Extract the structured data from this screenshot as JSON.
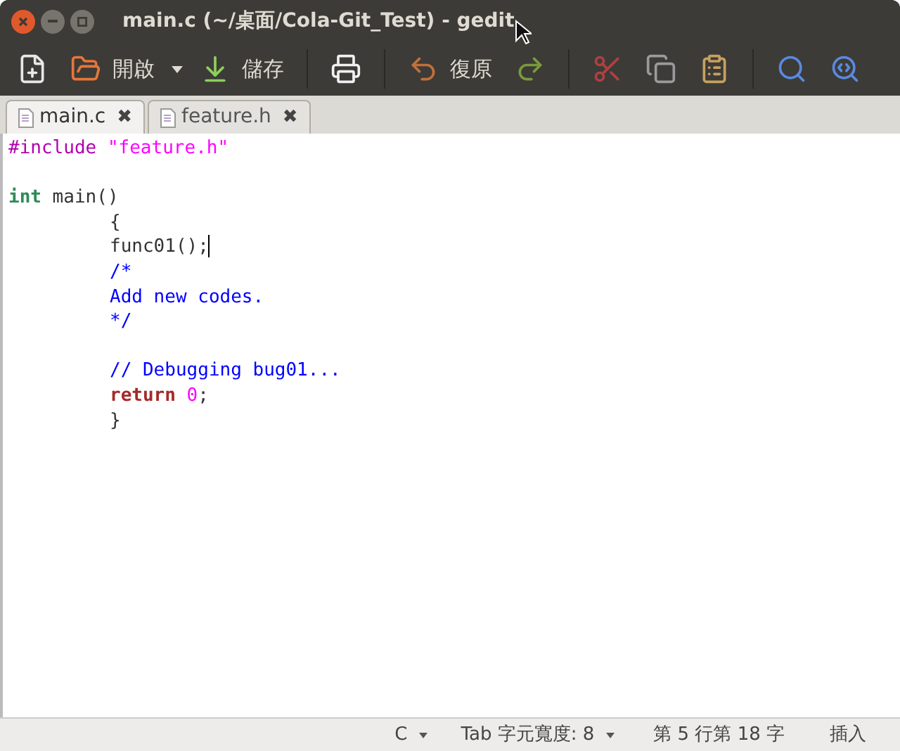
{
  "window": {
    "title": "main.c (~/桌面/Cola-Git_Test) - gedit"
  },
  "toolbar": [
    {
      "kind": "new"
    },
    {
      "kind": "open",
      "label": "開啟"
    },
    {
      "kind": "dropdown"
    },
    {
      "kind": "save",
      "label": "儲存"
    },
    {
      "kind": "separator"
    },
    {
      "kind": "print"
    },
    {
      "kind": "separator"
    },
    {
      "kind": "undo",
      "label": "復原"
    },
    {
      "kind": "redo"
    },
    {
      "kind": "separator"
    },
    {
      "kind": "cut"
    },
    {
      "kind": "copy"
    },
    {
      "kind": "paste"
    },
    {
      "kind": "separator"
    },
    {
      "kind": "find"
    },
    {
      "kind": "replace"
    }
  ],
  "tabs": [
    {
      "label": "main.c",
      "close": "✖",
      "selected": true
    },
    {
      "label": "feature.h",
      "close": "✖",
      "selected": false
    }
  ],
  "editor": {
    "lines": [
      {
        "kind": "code",
        "tokens": [
          {
            "kind": "preproc",
            "text": "#include "
          },
          {
            "kind": "string",
            "text": "\"feature.h\""
          }
        ]
      },
      {
        "kind": "blank"
      },
      {
        "kind": "code",
        "tokens": [
          {
            "kind": "type",
            "text": "int"
          },
          {
            "kind": "plain",
            "text": " main()"
          }
        ],
        "children": [
          {
            "kind": "code",
            "tokens": [
              {
                "kind": "plain",
                "text": "{"
              }
            ]
          },
          {
            "kind": "code",
            "cursor": true,
            "tokens": [
              {
                "kind": "plain",
                "text": "func01();"
              }
            ]
          },
          {
            "kind": "code",
            "tokens": [
              {
                "kind": "comment",
                "text": "/*"
              }
            ]
          },
          {
            "kind": "code",
            "tokens": [
              {
                "kind": "comment",
                "text": "Add new codes."
              }
            ]
          },
          {
            "kind": "code",
            "tokens": [
              {
                "kind": "comment",
                "text": "*/"
              }
            ]
          },
          {
            "kind": "blank"
          },
          {
            "kind": "code",
            "tokens": [
              {
                "kind": "comment",
                "text": "// Debugging bug01..."
              }
            ]
          },
          {
            "kind": "code",
            "tokens": [
              {
                "kind": "keyword",
                "text": "return "
              },
              {
                "kind": "number",
                "text": "0"
              },
              {
                "kind": "plain",
                "text": ";"
              }
            ]
          },
          {
            "kind": "code",
            "tokens": [
              {
                "kind": "plain",
                "text": "}"
              }
            ]
          }
        ]
      }
    ]
  },
  "status_bar": [
    {
      "kind": "menu",
      "text": "C"
    },
    {
      "kind": "menu",
      "text": "Tab 字元寬度: 8"
    },
    {
      "kind": "text",
      "text": "第 5 行第 18 字"
    },
    {
      "kind": "text",
      "text": "插入"
    }
  ]
}
